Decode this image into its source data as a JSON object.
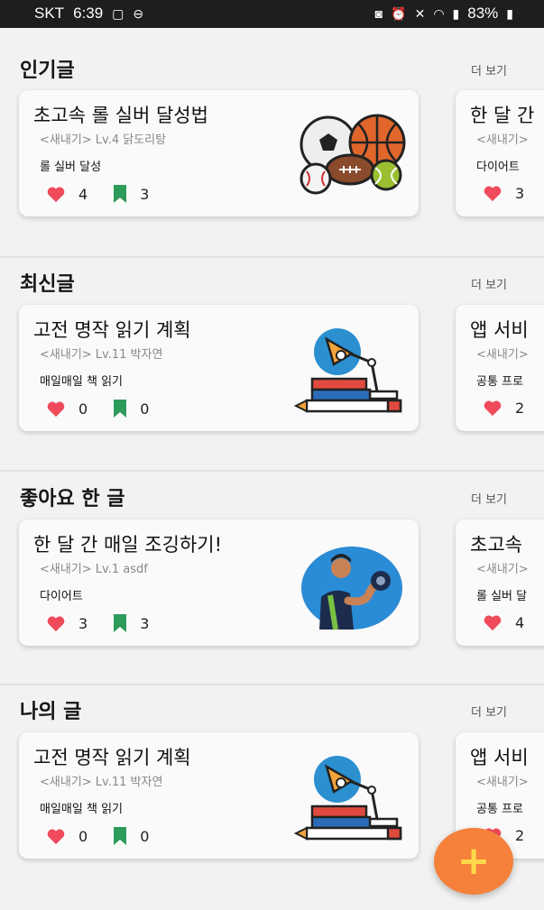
{
  "status_bar": {
    "carrier": "SKT",
    "time": "6:39",
    "battery": "83%"
  },
  "sections": [
    {
      "title": "인기글",
      "more": "더 보기",
      "cards": [
        {
          "title": "초고속 롤 실버 달성법",
          "meta": "<새내기> Lv.4 닭도리탕",
          "desc": "롤 실버 달성",
          "likes": "4",
          "bookmarks": "3",
          "illustration": "sports-balls-illustration"
        },
        {
          "title": "한 달 간",
          "meta": "<새내기>",
          "desc": "다이어트",
          "likes": "3"
        }
      ]
    },
    {
      "title": "최신글",
      "more": "더 보기",
      "cards": [
        {
          "title": "고전 명작 읽기 계획",
          "meta": "<새내기> Lv.11 박자연",
          "desc": "매일매일 책 읽기",
          "likes": "0",
          "bookmarks": "0",
          "illustration": "books-lamp-illustration"
        },
        {
          "title": "앱 서비",
          "meta": "<새내기>",
          "desc": "공통 프로",
          "likes": "2"
        }
      ]
    },
    {
      "title": "좋아요 한 글",
      "more": "더 보기",
      "cards": [
        {
          "title": "한 달 간 매일 조깅하기!",
          "meta": "<새내기> Lv.1 asdf",
          "desc": "다이어트",
          "likes": "3",
          "bookmarks": "3",
          "illustration": "dumbbell-man-illustration"
        },
        {
          "title": "초고속",
          "meta": "<새내기>",
          "desc": "롤 실버 달",
          "likes": "4"
        }
      ]
    },
    {
      "title": "나의 글",
      "more": "더 보기",
      "cards": [
        {
          "title": "고전 명작 읽기 계획",
          "meta": "<새내기> Lv.11 박자연",
          "desc": "매일매일 책 읽기",
          "likes": "0",
          "bookmarks": "0",
          "illustration": "books-lamp-illustration"
        },
        {
          "title": "앱 서비",
          "meta": "<새내기>",
          "desc": "공통 프로",
          "likes": "2"
        }
      ]
    }
  ],
  "fab": {
    "label": "+",
    "icon": "plus-icon"
  },
  "colors": {
    "heart": "#ef4b5b",
    "bookmark": "#2d9b5a",
    "fab": "#f5813a",
    "fab_plus": "#ffd84a"
  }
}
